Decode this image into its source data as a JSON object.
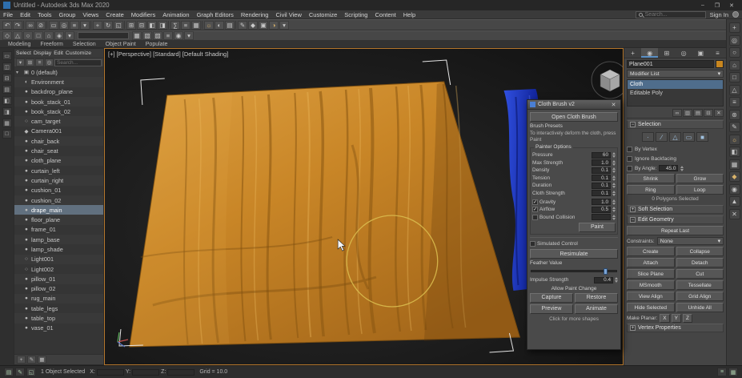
{
  "window": {
    "title": "Untitled - Autodesk 3ds Max 2020",
    "minimize": "–",
    "maximize": "❐",
    "close": "✕"
  },
  "menu": {
    "items": [
      "File",
      "Edit",
      "Tools",
      "Group",
      "Views",
      "Create",
      "Modifiers",
      "Animation",
      "Graph Editors",
      "Rendering",
      "Civil View",
      "Customize",
      "Scripting",
      "Content",
      "Help"
    ],
    "sign_in": "Sign In"
  },
  "search": {
    "placeholder": "Search..."
  },
  "toolbar_main": {
    "icons": [
      {
        "g": "↶"
      },
      {
        "g": "↷"
      },
      {
        "cls": "sep"
      },
      {
        "g": "∞"
      },
      {
        "g": "⊘"
      },
      {
        "cls": "sep"
      },
      {
        "g": "▭"
      },
      {
        "g": "◎"
      },
      {
        "g": "≡"
      },
      {
        "g": "▾"
      },
      {
        "cls": "sep"
      },
      {
        "g": "+"
      },
      {
        "g": "↻"
      },
      {
        "g": "◱"
      },
      {
        "cls": "sep"
      },
      {
        "g": "⊞"
      },
      {
        "g": "⊟"
      },
      {
        "g": "◧"
      },
      {
        "g": "◨"
      },
      {
        "cls": "sep"
      },
      {
        "g": "∑"
      },
      {
        "g": "≡"
      },
      {
        "g": "▦"
      },
      {
        "cls": "sep"
      },
      {
        "g": "☼",
        "cls": "warm"
      },
      {
        "g": "◐"
      },
      {
        "g": "▤"
      },
      {
        "cls": "sep"
      },
      {
        "g": "✎"
      },
      {
        "g": "◆"
      },
      {
        "g": "▣"
      },
      {
        "g": "◑",
        "cls": "warm"
      },
      {
        "g": "▾"
      }
    ]
  },
  "toolbar_second": {
    "icons1": [
      {
        "g": "◇"
      },
      {
        "g": "△"
      },
      {
        "g": "○"
      },
      {
        "g": "□"
      },
      {
        "g": "⌂"
      },
      {
        "g": "◈"
      },
      {
        "g": "▾"
      }
    ],
    "icons2": [
      {
        "g": "▦"
      },
      {
        "g": "▧"
      },
      {
        "g": "▨"
      },
      {
        "g": "≡"
      },
      {
        "g": "◉"
      },
      {
        "g": "▾"
      }
    ]
  },
  "ribbon": {
    "tabs": [
      "Modeling",
      "Freeform",
      "Selection",
      "Object Paint",
      "Populate"
    ]
  },
  "left_strip": {
    "icons": [
      "▭",
      "◫",
      "⊟",
      "▤",
      "◧",
      "◨",
      "▦",
      "□"
    ]
  },
  "explorer": {
    "menus": [
      "Select",
      "Display",
      "Edit",
      "Customize"
    ],
    "tools": [
      "▾",
      "⊞",
      "≡",
      "◎"
    ],
    "search_placeholder": "Search...",
    "rows": [
      {
        "exp": "▾",
        "icon": "▣",
        "label": "0 (default)"
      },
      {
        "icon": "◐",
        "label": "Environment"
      },
      {
        "icon": "●",
        "label": "backdrop_plane"
      },
      {
        "icon": "●",
        "label": "book_stack_01"
      },
      {
        "icon": "●",
        "label": "book_stack_02"
      },
      {
        "icon": "○",
        "label": "cam_target"
      },
      {
        "icon": "◆",
        "label": "Camera001"
      },
      {
        "icon": "●",
        "label": "chair_back"
      },
      {
        "icon": "●",
        "label": "chair_seat"
      },
      {
        "icon": "●",
        "label": "cloth_plane"
      },
      {
        "icon": "●",
        "label": "curtain_left"
      },
      {
        "icon": "●",
        "label": "curtain_right"
      },
      {
        "icon": "●",
        "label": "cushion_01"
      },
      {
        "icon": "●",
        "label": "cushion_02"
      },
      {
        "icon": "●",
        "label": "drape_main",
        "selected": true
      },
      {
        "icon": "●",
        "label": "floor_plane"
      },
      {
        "icon": "●",
        "label": "frame_01"
      },
      {
        "icon": "●",
        "label": "lamp_base"
      },
      {
        "icon": "●",
        "label": "lamp_shade"
      },
      {
        "icon": "○",
        "label": "Light001"
      },
      {
        "icon": "○",
        "label": "Light002"
      },
      {
        "icon": "●",
        "label": "pillow_01"
      },
      {
        "icon": "●",
        "label": "pillow_02"
      },
      {
        "icon": "●",
        "label": "rug_main"
      },
      {
        "icon": "●",
        "label": "table_legs"
      },
      {
        "icon": "●",
        "label": "table_top"
      },
      {
        "icon": "●",
        "label": "vase_01"
      }
    ],
    "footer_icons": [
      "+",
      "✎",
      "▦"
    ]
  },
  "viewport": {
    "label": "[+] [Perspective] [Standard] [Default Shading]",
    "colors": {
      "cloth": "#c98627",
      "brush_ring": "#d9bb4e",
      "blue_cloth": "#1c32c0"
    }
  },
  "dialog": {
    "title": "Cloth Brush v2",
    "close": "✕",
    "open_btn": "Open Cloth Brush",
    "preset_label": "Brush Presets",
    "desc": "To interactively deform the cloth, press Paint",
    "options_title": "Painter Options",
    "params": [
      {
        "label": "Pressure",
        "value": "60"
      },
      {
        "label": "Max Strength",
        "value": "1.0"
      },
      {
        "label": "Density",
        "value": "0.1"
      },
      {
        "label": "Tension",
        "value": "0.1"
      },
      {
        "label": "Duration",
        "value": "0.1"
      },
      {
        "label": "Cloth Strength",
        "value": "0.1"
      }
    ],
    "checks": [
      {
        "label": "Gravity",
        "value": "1.0",
        "on": true
      },
      {
        "label": "Airflow",
        "value": "0.5",
        "on": true
      },
      {
        "label": "Bound Collision",
        "value": "",
        "on": false
      }
    ],
    "paint_btn": "Paint",
    "sim_check": "Simulated Control",
    "resim_btn": "Resimulate",
    "feather_label": "Feather Value",
    "impulse_label": "Impulse Strength",
    "impulse_value": "0.4",
    "change_label": "Allow Paint Change",
    "grid_buttons": [
      "Capture",
      "Restore",
      "Preview",
      "Animate"
    ],
    "footer": "Click for more shapes"
  },
  "command_panel": {
    "tabs": [
      {
        "g": "+"
      },
      {
        "g": "◉",
        "cls": "active"
      },
      {
        "g": "⊞"
      },
      {
        "g": "◎"
      },
      {
        "g": "▣"
      },
      {
        "g": "≡"
      }
    ],
    "object_name": "Plane001",
    "modifier_list_label": "Modifier List",
    "ddl_arrow": "▾",
    "stack": [
      {
        "label": "Cloth",
        "selected": true
      },
      {
        "label": "Editable Poly"
      }
    ],
    "stack_icons": [
      "∞",
      "▥",
      "▤",
      "⊟",
      "✕"
    ],
    "rollouts": {
      "selection": {
        "sign": "−",
        "title": "Selection",
        "icons": [
          "·",
          "∕",
          "△",
          "▭",
          "■"
        ],
        "checks": [
          "By Vertex",
          "Ignore Backfacing"
        ],
        "angle_label": "By Angle:",
        "angle_value": "45.0",
        "pairs1": [
          "Shrink",
          "Grow"
        ],
        "pairs2": [
          "Ring",
          "Loop"
        ],
        "status": "0 Polygons Selected"
      },
      "soft": {
        "sign": "+",
        "title": "Soft Selection"
      },
      "editgeo": {
        "sign": "−",
        "title": "Edit Geometry",
        "repeat_btn": "Repeat Last",
        "constraints_label": "Constraints:",
        "constraints_value": "None",
        "pairs": [
          [
            "Create",
            "Collapse"
          ],
          [
            "Attach",
            "Detach"
          ],
          [
            "Slice Plane",
            "Cut"
          ],
          [
            "MSmooth",
            "Tessellate"
          ],
          [
            "View Align",
            "Grid Align"
          ],
          [
            "Hide Selected",
            "Unhide All"
          ]
        ],
        "planar_label": "Make Planar:",
        "planar_axes": [
          "X",
          "Y",
          "Z"
        ]
      },
      "vertexprops": {
        "sign": "+",
        "title": "Vertex Properties"
      }
    }
  },
  "right_strip": {
    "icons": [
      {
        "g": "+"
      },
      {
        "g": "◎"
      },
      {
        "g": "○"
      },
      {
        "g": "⌂"
      },
      {
        "g": "□"
      },
      {
        "g": "△"
      },
      {
        "g": "≡"
      },
      {
        "g": "⊛"
      },
      {
        "g": "✎"
      },
      {
        "g": "☼",
        "cls": "warm"
      },
      {
        "g": "◧"
      },
      {
        "g": "▦"
      },
      {
        "g": "◆",
        "cls": "warm"
      },
      {
        "g": "◉"
      },
      {
        "g": "▲"
      },
      {
        "g": "✕"
      }
    ]
  },
  "status_bar": {
    "icons_left": [
      "▤",
      "✎",
      "◱"
    ],
    "message": "1 Object Selected",
    "x_label": "X:",
    "y_label": "Y:",
    "z_label": "Z:",
    "x": "",
    "y": "",
    "z": "",
    "grid": "Grid = 10.0",
    "right_icons": [
      "≡",
      "▦"
    ]
  }
}
